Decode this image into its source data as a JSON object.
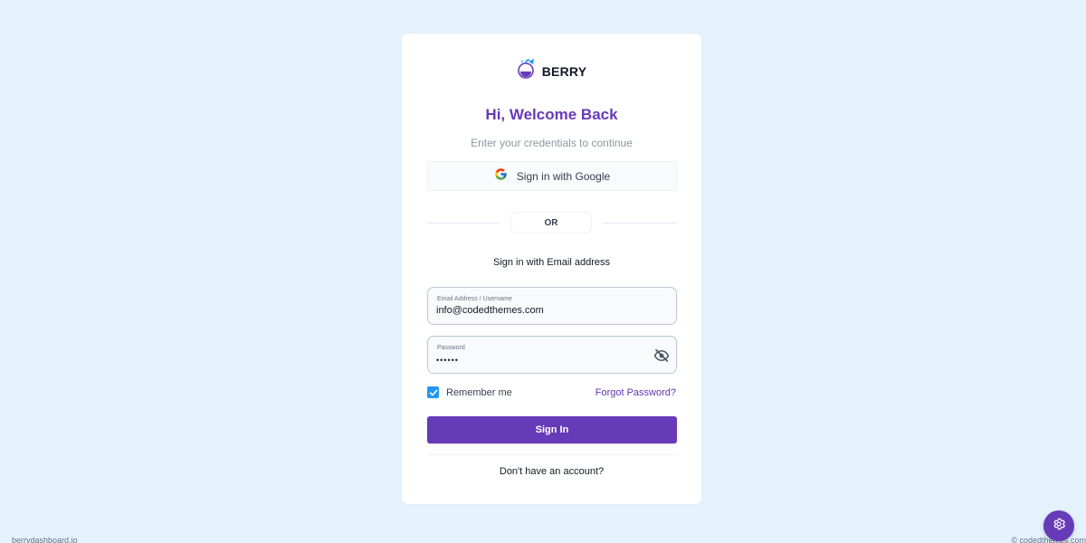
{
  "brand": {
    "name": "BERRY",
    "logo_icon": "berry-logo-icon"
  },
  "header": {
    "title": "Hi, Welcome Back",
    "subtitle": "Enter your credentials to continue"
  },
  "social": {
    "google_label": "Sign in with Google",
    "google_icon": "google-icon"
  },
  "divider": {
    "label": "OR"
  },
  "email_section": {
    "heading": "Sign in with Email address"
  },
  "form": {
    "email": {
      "label": "Email Address / Username",
      "value": "info@codedthemes.com"
    },
    "password": {
      "label": "Password",
      "value": "••••••",
      "toggle_icon": "eye-off-icon"
    },
    "remember": {
      "label": "Remember me",
      "checked": true
    },
    "forgot_label": "Forgot Password?",
    "submit_label": "Sign In",
    "no_account_label": "Don't have an account?"
  },
  "footer": {
    "left": "berrydashboard.io",
    "right": "© codedthemes.com"
  },
  "settings_fab": {
    "icon": "gear-icon"
  },
  "colors": {
    "primary": "#673ab7",
    "secondary": "#2196f3",
    "background": "#e3f2fd"
  }
}
